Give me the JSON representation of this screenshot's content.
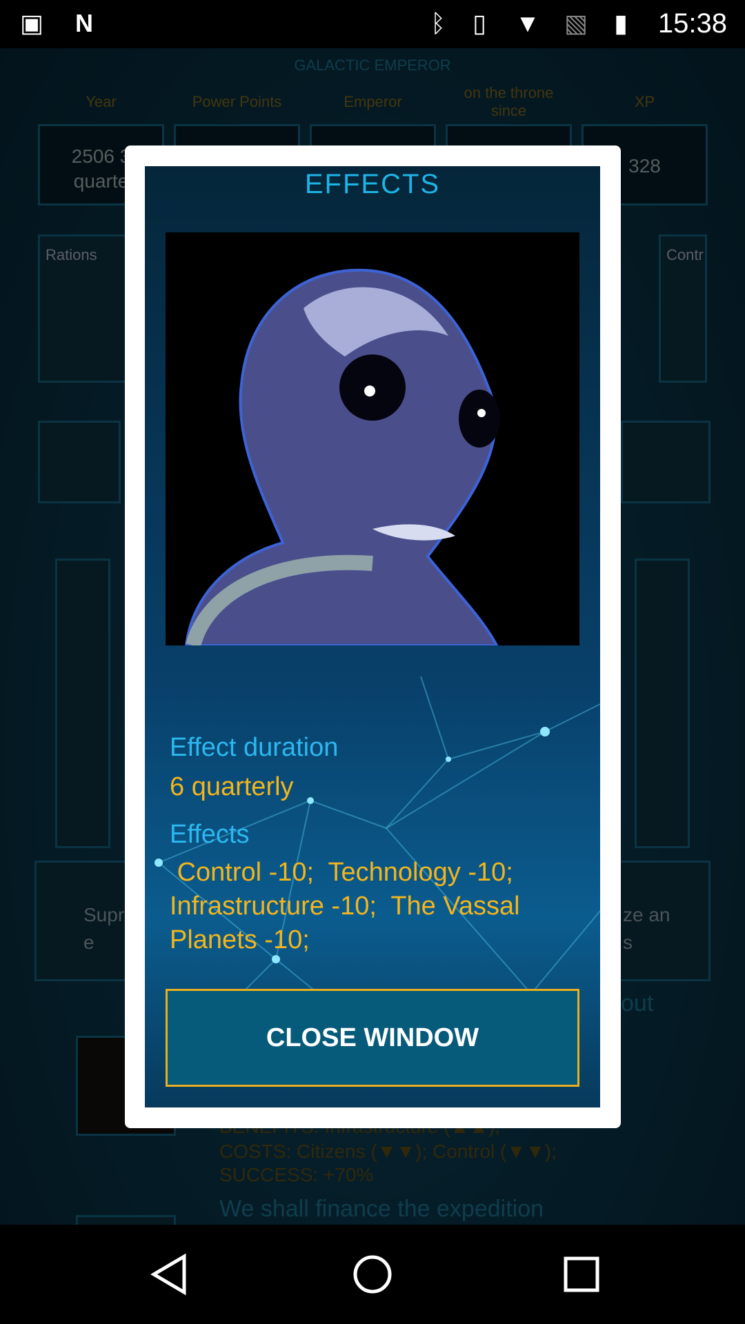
{
  "status_bar": {
    "time": "15:38",
    "icons": [
      "image-icon",
      "n-icon",
      "bluetooth-icon",
      "vibrate-icon",
      "wifi-icon",
      "no-sim-icon",
      "battery-charging-icon"
    ]
  },
  "background": {
    "title": "GALACTIC EMPEROR",
    "columns": [
      {
        "label": "Year",
        "value": "2506  3\nquarte"
      },
      {
        "label": "Power Points",
        "value": ""
      },
      {
        "label": "Emperor",
        "value": ""
      },
      {
        "label": "on the throne since",
        "value": ""
      },
      {
        "label": "XP",
        "value": "328"
      }
    ],
    "cards": {
      "left": "Rations",
      "right": "Contr"
    },
    "partial_left_text": "Supr\ne",
    "partial_right_text": "ze an\ns",
    "partial_out": "out",
    "benefits": "BENEFITS: Infrastructure (▲▲);",
    "costs": "COSTS: Citizens (▼▼); Control (▼▼);",
    "success": "SUCCESS: +70%",
    "option": "We shall finance the expedition"
  },
  "dialog": {
    "title": "EFFECTS",
    "duration_label": "Effect duration",
    "duration_value": "6 quarterly",
    "effects_label": "Effects",
    "effects_value": " Control -10;  Technology -10;  Infrastructure -10;  The Vassal Planets -10;",
    "close_label": "CLOSE WINDOW",
    "accent": "#e8b020",
    "button_color": "#065a7a"
  },
  "nav": {
    "icons": [
      "back-icon",
      "home-icon",
      "recents-icon"
    ]
  }
}
